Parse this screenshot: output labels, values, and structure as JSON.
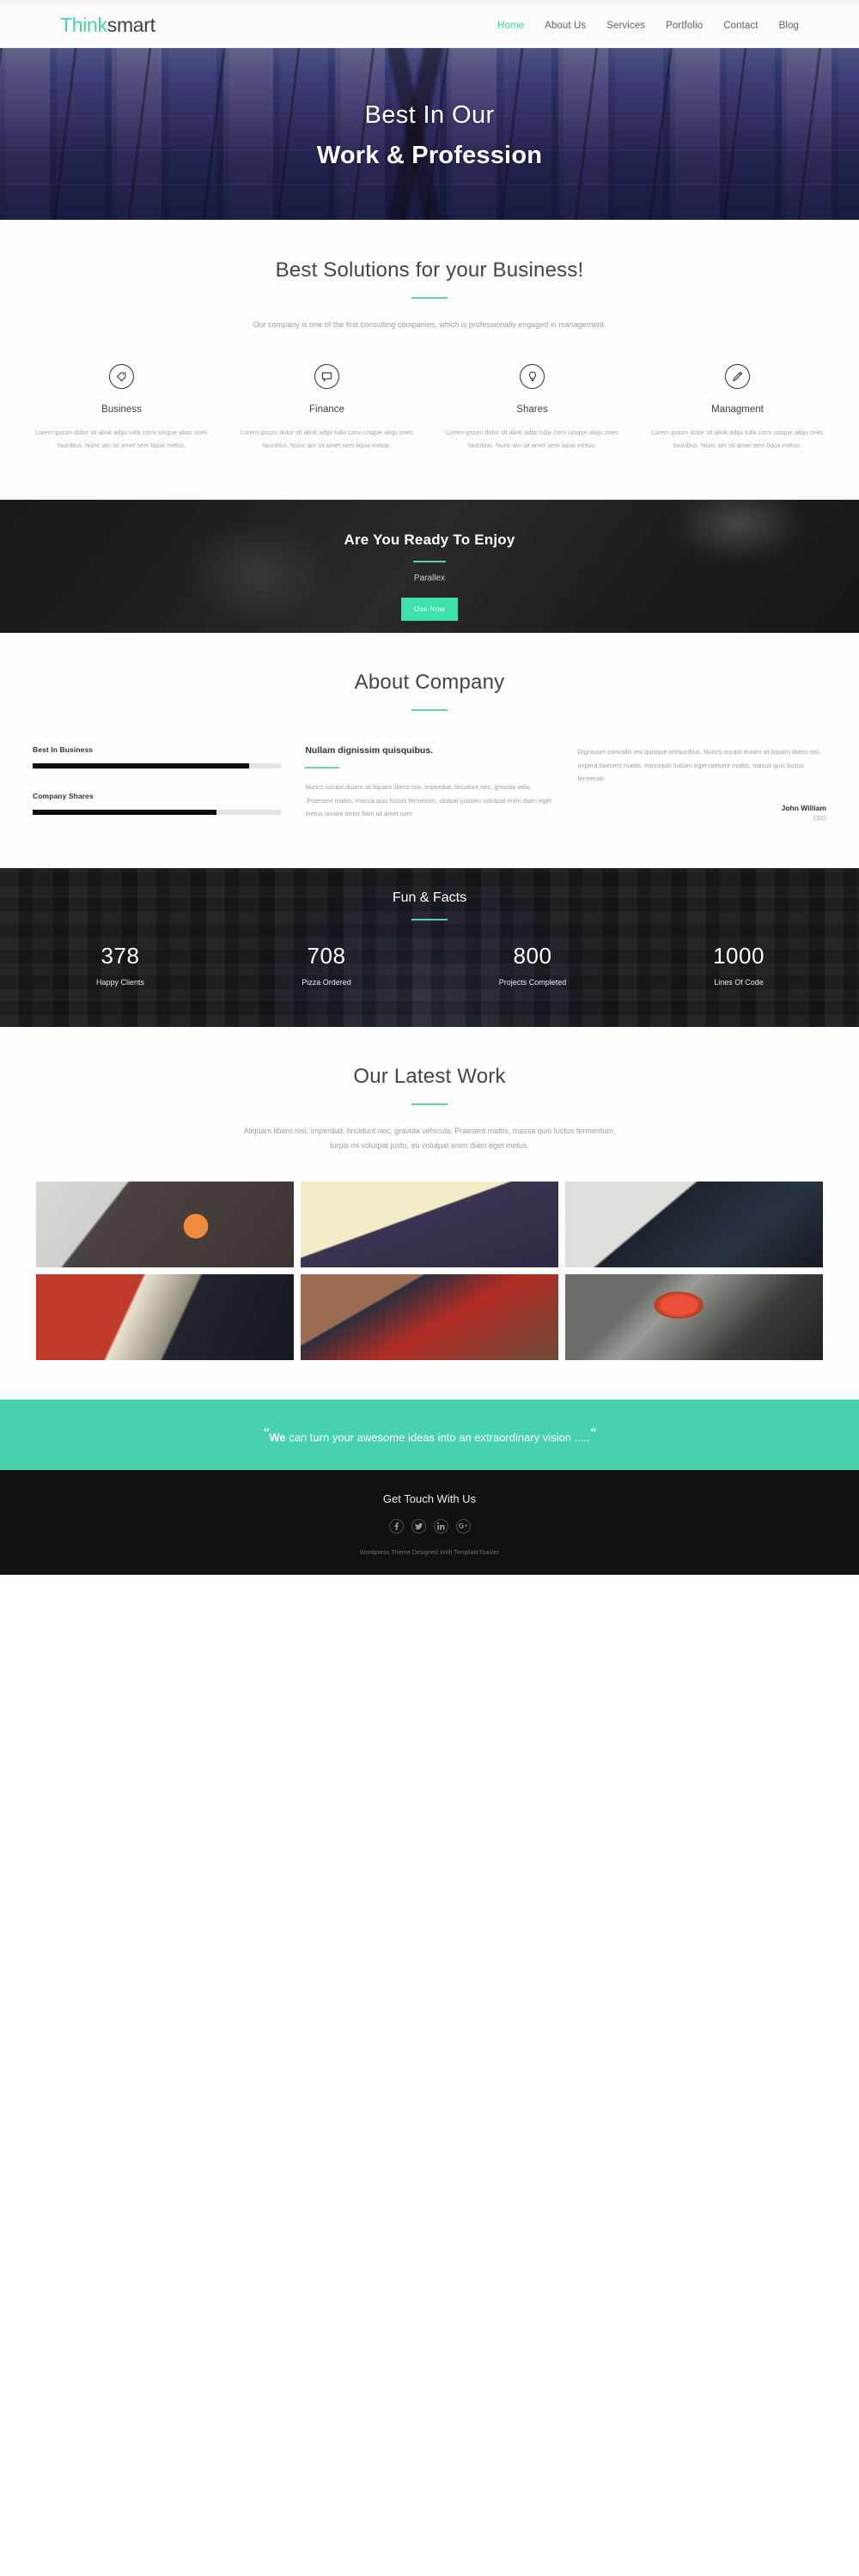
{
  "header": {
    "logo_think": "Think",
    "logo_smart": "smart",
    "nav": [
      {
        "label": "Home",
        "active": true
      },
      {
        "label": "About Us",
        "active": false
      },
      {
        "label": "Services",
        "active": false
      },
      {
        "label": "Portfolio",
        "active": false
      },
      {
        "label": "Contact",
        "active": false
      },
      {
        "label": "Blog",
        "active": false
      }
    ]
  },
  "hero": {
    "line1": "Best In Our",
    "line2": "Work & Profession",
    "image_description": "modern glass and steel building facade seen from below, purple blue tones"
  },
  "services": {
    "title": "Best Solutions for your Business!",
    "subtitle": "Our company is one of the first consulting companies, which is professionally engaged in management.",
    "body": "Lorem ipsum dolor sit alink adipi tulla conv uisque aliqu onec faucibus. Nunc am sit amet sem liqua metus.",
    "items": [
      {
        "name": "Business",
        "icon": "tag-icon"
      },
      {
        "name": "Finance",
        "icon": "speech-bubble-icon"
      },
      {
        "name": "Shares",
        "icon": "lightbulb-icon"
      },
      {
        "name": "Managment",
        "icon": "pencil-icon"
      }
    ]
  },
  "cta": {
    "heading": "Are You Ready To Enjoy",
    "subheading": "Parallex",
    "button_label": "Use Now",
    "button_color": "#3ee0ae",
    "image_description": "dark grayscale photo of hands using a smartphone on a desk with a coffee cup"
  },
  "about": {
    "title": "About Company",
    "bars": [
      {
        "label": "Best In Business",
        "percent": 87
      },
      {
        "label": "Company Shares",
        "percent": 74
      }
    ],
    "mid_heading": "Nullam dignissim quisquibus.",
    "mid_body": "Nuncs sucipit duiam sit liquam libero nisi, imperdiat, tincidunt nec, gravida vela, .Praesent mattis, massa quis luctus fermentm, olutpat justoeu volutpat enim diam eget metus ornare tortor fiam sit amet sem",
    "right_body": "Dignissim convallis est quisque onfaucibus. Nuncs sucipit duiam sit liquam libero nisi, imperd tiaesent mattis, massquis ludiam eget raesent mattis, massa quis luctus fermenat.",
    "author_name": "John William",
    "author_role": "CEO"
  },
  "facts": {
    "title": "Fun & Facts",
    "image_description": "night city street with illuminated billboards, Times Square style, dark overlay",
    "items": [
      {
        "number": "378",
        "label": "Happy Clients"
      },
      {
        "number": "708",
        "label": "Pizza Ordered"
      },
      {
        "number": "800",
        "label": "Projects Completed"
      },
      {
        "number": "1000",
        "label": "Lines Of Code"
      }
    ]
  },
  "portfolio": {
    "title": "Our Latest Work",
    "subtitle_line1": "Aliquam libero nisi, imperdiat, tincidunt nec, gravida vehicula,  Praesent mattis, massa quis luctus fermentum,",
    "subtitle_line2": "turpis mi volutpat justo, eu volutpat enim diam eget metus.",
    "items": [
      {
        "image_description": "white keyboard beside smartphone with orange music app screen and earbuds"
      },
      {
        "image_description": "overhead desk shot with laptop, coffee mug, notebook and phone"
      },
      {
        "image_description": "tablet resting on a keyboard displaying a website"
      },
      {
        "image_description": "person in red shirt typing code on a laptop"
      },
      {
        "image_description": "two people at a desk with red notebook and silver laptop"
      },
      {
        "image_description": "open laptop with colorful red wallpaper on a desk with sunglasses"
      }
    ]
  },
  "quote": {
    "mark_open": "“",
    "mark_close": "“",
    "bold_word": "We",
    "rest": " can turn your awesome ideas into an extraordinary vision .....",
    "background_color": "#47d2ad"
  },
  "footer": {
    "heading": "Get Touch With Us",
    "social": [
      {
        "name": "facebook-icon",
        "glyph": "f"
      },
      {
        "name": "twitter-icon",
        "glyph": "t"
      },
      {
        "name": "linkedin-icon",
        "glyph": "in"
      },
      {
        "name": "google-plus-icon",
        "glyph": "g+"
      }
    ],
    "copyright": "Wordpress Theme Designed With TemplateToaster"
  },
  "theme": {
    "accent": "#4ad3a8",
    "dark": "#111113"
  }
}
